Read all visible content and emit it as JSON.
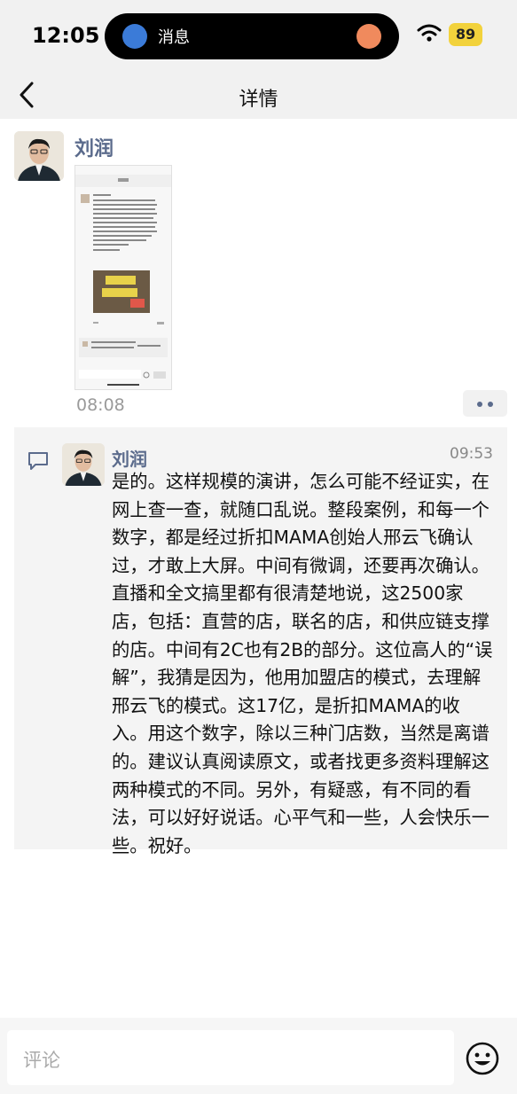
{
  "status_bar": {
    "time": "12:05",
    "island_label": "消息",
    "battery": "89"
  },
  "nav": {
    "title": "详情"
  },
  "post": {
    "author": "刘润",
    "time": "08:08"
  },
  "comment": {
    "author": "刘润",
    "time": "09:53",
    "text": "是的。这样规模的演讲，怎么可能不经证实，在网上查一查，就随口乱说。整段案例，和每一个数字，都是经过折扣MAMA创始人邢云飞确认过，才敢上大屏。中间有微调，还要再次确认。直播和全文搞里都有很清楚地说，这2500家店，包括：直营的店，联名的店，和供应链支撑的店。中间有2C也有2B的部分。这位高人的“误解”，我猜是因为，他用加盟店的模式，去理解邢云飞的模式。这17亿，是折扣MAMA的收入。用这个数字，除以三种门店数，当然是离谱的。建议认真阅读原文，或者找更多资料理解这两种模式的不同。另外，有疑惑，有不同的看法，可以好好说话。心平气和一些，人会快乐一些。祝好。"
  },
  "input": {
    "placeholder": "评论"
  },
  "colors": {
    "accent_name": "#5b6b8c",
    "battery": "#f2d23c"
  },
  "icons": [
    "wifi-icon",
    "back-chevron-icon",
    "more-icon",
    "comment-icon",
    "emoji-icon"
  ]
}
